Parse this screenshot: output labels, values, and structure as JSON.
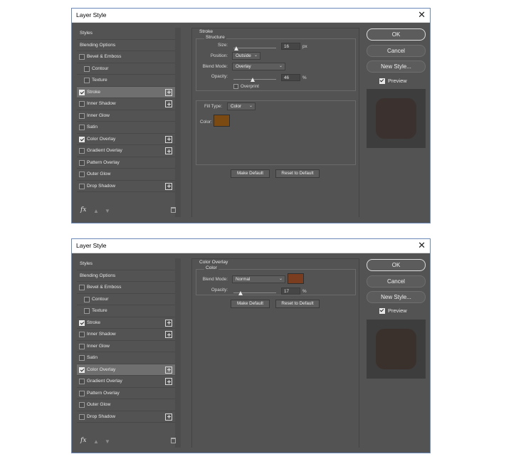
{
  "dialogs": [
    {
      "title": "Layer Style",
      "close_glyph": "✕",
      "styles_header": "Styles",
      "blending_options": "Blending Options",
      "items": [
        {
          "label": "Bevel & Emboss",
          "checked": false,
          "plus": false
        },
        {
          "label": "Contour",
          "checked": false,
          "plus": false,
          "indent": true
        },
        {
          "label": "Texture",
          "checked": false,
          "plus": false,
          "indent": true
        },
        {
          "label": "Stroke",
          "checked": true,
          "plus": true,
          "selected": true
        },
        {
          "label": "Inner Shadow",
          "checked": false,
          "plus": true
        },
        {
          "label": "Inner Glow",
          "checked": false,
          "plus": false
        },
        {
          "label": "Satin",
          "checked": false,
          "plus": false
        },
        {
          "label": "Color Overlay",
          "checked": true,
          "plus": true
        },
        {
          "label": "Gradient Overlay",
          "checked": false,
          "plus": true
        },
        {
          "label": "Pattern Overlay",
          "checked": false,
          "plus": false
        },
        {
          "label": "Outer Glow",
          "checked": false,
          "plus": false
        },
        {
          "label": "Drop Shadow",
          "checked": false,
          "plus": true
        }
      ],
      "fx_label": "fx",
      "stroke": {
        "section": "Stroke",
        "structure": "Structure",
        "size_label": "Size:",
        "size_value": "16",
        "size_unit": "px",
        "size_level": 0.08,
        "position_label": "Position:",
        "position_value": "Outside",
        "blend_label": "Blend Mode:",
        "blend_value": "Overlay",
        "opacity_label": "Opacity:",
        "opacity_value": "46",
        "opacity_unit": "%",
        "opacity_level": 0.46,
        "overprint_label": "Overprint",
        "fill_type_label": "Fill Type:",
        "fill_type_value": "Color",
        "color_label": "Color:",
        "color_hex": "#7a4a12",
        "make_default": "Make Default",
        "reset_default": "Reset to Default"
      },
      "buttons": {
        "ok": "OK",
        "cancel": "Cancel",
        "new_style": "New Style..."
      },
      "preview_label": "Preview",
      "preview_color": "#3b312e"
    },
    {
      "title": "Layer Style",
      "close_glyph": "✕",
      "styles_header": "Styles",
      "blending_options": "Blending Options",
      "items": [
        {
          "label": "Bevel & Emboss",
          "checked": false,
          "plus": false
        },
        {
          "label": "Contour",
          "checked": false,
          "plus": false,
          "indent": true
        },
        {
          "label": "Texture",
          "checked": false,
          "plus": false,
          "indent": true
        },
        {
          "label": "Stroke",
          "checked": true,
          "plus": true
        },
        {
          "label": "Inner Shadow",
          "checked": false,
          "plus": true
        },
        {
          "label": "Inner Glow",
          "checked": false,
          "plus": false
        },
        {
          "label": "Satin",
          "checked": false,
          "plus": false
        },
        {
          "label": "Color Overlay",
          "checked": true,
          "plus": true,
          "selected": true
        },
        {
          "label": "Gradient Overlay",
          "checked": false,
          "plus": true
        },
        {
          "label": "Pattern Overlay",
          "checked": false,
          "plus": false
        },
        {
          "label": "Outer Glow",
          "checked": false,
          "plus": false
        },
        {
          "label": "Drop Shadow",
          "checked": false,
          "plus": true
        }
      ],
      "fx_label": "fx",
      "overlay": {
        "section": "Color Overlay",
        "subsection": "Color",
        "blend_label": "Blend Mode:",
        "blend_value": "Normal",
        "color_hex": "#7a3d1f",
        "opacity_label": "Opacity:",
        "opacity_value": "17",
        "opacity_unit": "%",
        "opacity_level": 0.17,
        "make_default": "Make Default",
        "reset_default": "Reset to Default"
      },
      "buttons": {
        "ok": "OK",
        "cancel": "Cancel",
        "new_style": "New Style..."
      },
      "preview_label": "Preview",
      "preview_color": "#3a312d"
    }
  ]
}
